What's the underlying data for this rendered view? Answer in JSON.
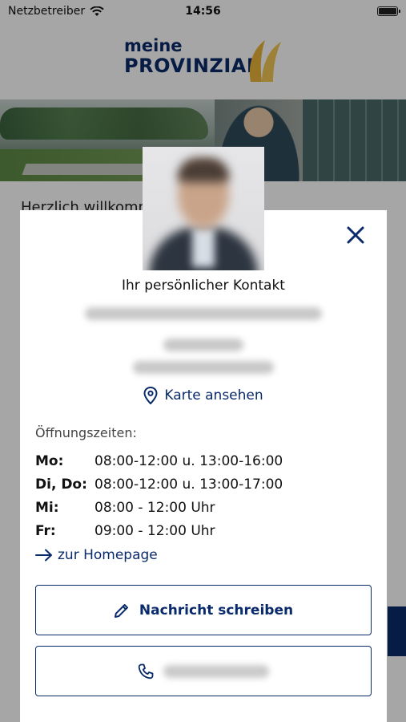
{
  "status": {
    "carrier": "Netzbetreiber",
    "time": "14:56"
  },
  "app": {
    "logo_top": "meine",
    "logo_bottom": "PROVINZIAL",
    "welcome": "Herzlich willkommen"
  },
  "modal": {
    "title": "Ihr persönlicher Kontakt",
    "map_link": "Karte ansehen",
    "hours_heading": "Öffnungszeiten:",
    "hours": [
      {
        "day": "Mo:",
        "time": "08:00-12:00 u. 13:00-16:00"
      },
      {
        "day": "Di, Do:",
        "time": "08:00-12:00 u. 13:00-17:00"
      },
      {
        "day": "Mi:",
        "time": "08:00 - 12:00 Uhr"
      },
      {
        "day": "Fr:",
        "time": "09:00 - 12:00 Uhr"
      }
    ],
    "homepage_link": "zur Homepage",
    "message_button": "Nachricht schreiben"
  },
  "colors": {
    "brand": "#0a2b6b",
    "overlay": "rgba(0,0,0,0.35)"
  },
  "icons": {
    "close": "close-icon",
    "map": "map-pin-icon",
    "homepage": "arrow-right-icon",
    "message": "pencil-icon",
    "call": "phone-icon"
  }
}
